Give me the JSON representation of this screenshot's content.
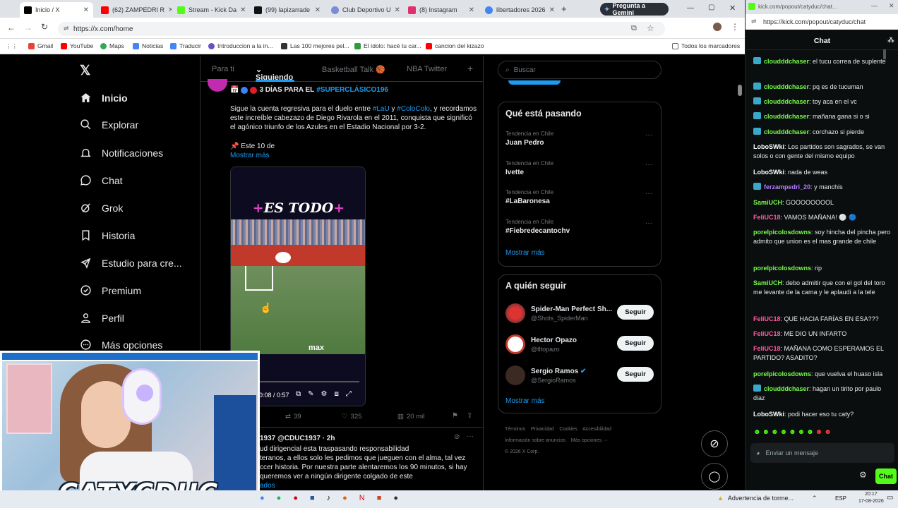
{
  "browser": {
    "tabs": [
      {
        "label": "Inicio / X",
        "color": "#000000"
      },
      {
        "label": "(62) ZAMPEDRI R",
        "color": "#ff0000"
      },
      {
        "label": "Stream - Kick Da",
        "color": "#53fc18"
      },
      {
        "label": "(99) lapizarrade",
        "color": "#111111"
      },
      {
        "label": "Club Deportivo U",
        "color": "#7b8bd4"
      },
      {
        "label": "(8) Instagram",
        "color": "#e1306c"
      },
      {
        "label": "libertadores 2026",
        "color": "#4285f4"
      }
    ],
    "gemini_label": "Pregunta a Gemini",
    "url": "https://x.com/home",
    "bookmarks": [
      "Gmail",
      "YouTube",
      "Maps",
      "Noticias",
      "Traducir",
      "Introduccion a la in...",
      "Las 100 mejores pel...",
      "El ídolo: hacé tu car...",
      "cancion del kizazo"
    ],
    "all_bookmarks": "Todos los marcadores"
  },
  "x": {
    "nav": [
      "Inicio",
      "Explorar",
      "Notificaciones",
      "Chat",
      "Grok",
      "Historia",
      "Estudio para cre...",
      "Premium",
      "Perfil",
      "Más opciones"
    ],
    "tabs": {
      "t1": "Para ti",
      "t2": "Siguiendo",
      "t3": "Basketball Talk 🏀",
      "t4": "NBA Twitter",
      "plus": "+"
    },
    "post": {
      "head": "3 DÍAS PARA EL",
      "hashtag": "#SUPERCLÁSICO196",
      "b1": "Sigue la cuenta regresiva para el duelo entre",
      "h1": "#LaU",
      "and": "y",
      "h2": "#ColoColo",
      "b2": ", y recordamos este increíble cabezazo de Diego Rivarola en el 2011, conquista que significó el agónico triunfo de los Azules en el Estadio Nacional por 3-2.",
      "pin": "📌 Este 10 de",
      "more": "Mostrar más",
      "video_title": "ES TODO",
      "video_time": "0:08 / 0:57",
      "video_brand": "max",
      "retweets": "39",
      "likes": "325",
      "views": "20 mil"
    },
    "post2": {
      "handle": "1937 @CDUC1937 · 2h",
      "l1": "ud dirigencial esta traspasando responsabilidad",
      "l2": "teranos, a ellos solo les pedimos que jueguen con el alma, tal vez",
      "l3": "ccer historia. Por nuestra parte alentaremos los 90 minutos, si hay",
      "l4": "queremos ver a ningún dirigente colgado de este",
      "l5": "ados"
    },
    "search_placeholder": "Buscar",
    "trending": {
      "title": "Qué está pasando",
      "items": [
        {
          "ctx": "Tendencia en Chile",
          "name": "Juan Pedro"
        },
        {
          "ctx": "Tendencia en Chile",
          "name": "Ivette"
        },
        {
          "ctx": "Tendencia en Chile",
          "name": "#LaBaronesa"
        },
        {
          "ctx": "Tendencia en Chile",
          "name": "#Fiebredecantochv"
        }
      ],
      "more": "Mostrar más"
    },
    "who": {
      "title": "A quién seguir",
      "items": [
        {
          "name": "Spider-Man Perfect Sh...",
          "handle": "@Shots_SpiderMan",
          "btn": "Seguir"
        },
        {
          "name": "Hector Opazo",
          "handle": "@tltopazo",
          "btn": "Seguir"
        },
        {
          "name": "Sergio Ramos",
          "handle": "@SergioRamos",
          "btn": "Seguir"
        }
      ],
      "more": "Mostrar más"
    },
    "footer": {
      "l1": "Términos    Privacidad    Cookies    Accesibilidad",
      "l2": "Información sobre anuncios    Más opciones ···",
      "l3": "© 2026 X Corp."
    }
  },
  "kick": {
    "url": "https://kick.com/popout/catyduc/chat",
    "url_small": "kick.com/popout/catyduc/chat...",
    "title": "Chat",
    "messages": [
      {
        "user": "cloudddchaser",
        "color": "#75fd46",
        "text": "el tucu correa de suplente",
        "badge": true
      },
      {
        "user": "cloudddchaser",
        "color": "#75fd46",
        "text": "pq es de tucuman",
        "badge": true
      },
      {
        "user": "cloudddchaser",
        "color": "#75fd46",
        "text": "toy aca en el vc",
        "badge": true
      },
      {
        "user": "cloudddchaser",
        "color": "#75fd46",
        "text": "mañana gana si o si",
        "badge": true
      },
      {
        "user": "cloudddchaser",
        "color": "#75fd46",
        "text": "corchazo si pierde",
        "badge": true
      },
      {
        "user": "LoboSWki",
        "color": "#ffffff",
        "text": "Los partidos son sagrados, se van solos o con gente del mismo equipo",
        "badge": false
      },
      {
        "user": "LoboSWki",
        "color": "#ffffff",
        "text": "nada de weas",
        "badge": false
      },
      {
        "user": "ferzampedri_20",
        "color": "#b57cff",
        "text": "y manchis",
        "badge": true
      },
      {
        "user": "SamiUCH",
        "color": "#75fd46",
        "text": "GOOOOOOOOL",
        "badge": false
      },
      {
        "user": "FeliUC18",
        "color": "#ff5aa0",
        "text": "VAMOS MAÑANA! ⚪ 🔵",
        "badge": false
      },
      {
        "user": "porelpicolosdowns",
        "color": "#75fd46",
        "text": "soy hincha del pincha pero admito que union es el mas grande de chile",
        "badge": false
      },
      {
        "user": "porelpicolosdowns",
        "color": "#75fd46",
        "text": "rip",
        "badge": false
      },
      {
        "user": "SamiUCH",
        "color": "#75fd46",
        "text": "debo admitir que con el gol del toro me levante de la cama y le aplaudi a la tele",
        "badge": false
      },
      {
        "user": "FeliUC18",
        "color": "#ff5aa0",
        "text": "QUE HACIA FARÍAS EN ESA???",
        "badge": false
      },
      {
        "user": "FeliUC18",
        "color": "#ff5aa0",
        "text": "ME DIO UN INFARTO",
        "badge": false
      },
      {
        "user": "FeliUC18",
        "color": "#ff5aa0",
        "text": "MAÑANA COMO ESPERAMOS EL PARTIDO? ASADITO?",
        "badge": false
      },
      {
        "user": "porelpicolosdowns",
        "color": "#75fd46",
        "text": "que vuelva el huaso isla",
        "badge": false
      },
      {
        "user": "cloudddchaser",
        "color": "#75fd46",
        "text": "hagan un tirito por paulo diaz",
        "badge": true
      },
      {
        "user": "LoboSWki",
        "color": "#ffffff",
        "text": "podi hacer eso tu caty?",
        "badge": false
      }
    ],
    "input_placeholder": "Enviar un mensaje",
    "send_label": "Chat"
  },
  "webcam": {
    "overlay_name": "CATYCDUC"
  },
  "taskbar": {
    "weather": "Advertencia de torme...",
    "lang": "ESP",
    "time": "20:17",
    "date": "17-08-2026"
  }
}
